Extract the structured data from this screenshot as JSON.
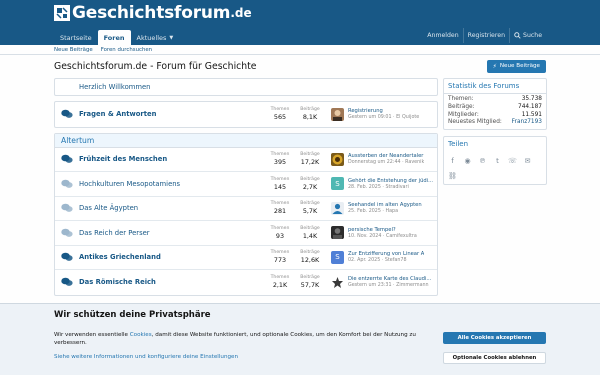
{
  "header": {
    "logo_text": "Geschichtsforum",
    "logo_tld": ".de",
    "nav": [
      {
        "label": "Startseite"
      },
      {
        "label": "Foren"
      },
      {
        "label": "Aktuelles"
      }
    ],
    "login": "Anmelden",
    "register": "Registrieren",
    "search": "Suche"
  },
  "subnav": [
    "Neue Beiträge",
    "Foren durchsuchen"
  ],
  "page": {
    "title": "Geschichtsforum.de - Forum für Geschichte",
    "new_posts_button": "Neue Beiträge"
  },
  "welcome": "Herzlich Willkommen",
  "labels": {
    "threads": "Themen",
    "posts": "Beiträge"
  },
  "qa_forum": {
    "name": "Fragen & Antworten",
    "threads": "565",
    "posts": "8,1K",
    "latest_title": "Registrierung",
    "latest_meta": "Gestern um 09:01 · El Quijote"
  },
  "section": {
    "title": "Altertum",
    "forums": [
      {
        "name": "Frühzeit des Menschen",
        "threads": "395",
        "posts": "17,2K",
        "latest_title": "Aussterben der Neandertaler",
        "latest_meta": "Donnerstag um 22:44 · Ravenik"
      },
      {
        "name": "Hochkulturen Mesopotamiens",
        "threads": "145",
        "posts": "2,7K",
        "latest_title": "Gehört die Entstehung der jüdi...",
        "latest_meta": "28. Feb. 2025 · Stradivari",
        "avatar_letter": "S"
      },
      {
        "name": "Das Alte Ägypten",
        "threads": "281",
        "posts": "5,7K",
        "latest_title": "Seehandel im alten Ägypten",
        "latest_meta": "25. Feb. 2025 · Hapa"
      },
      {
        "name": "Das Reich der Perser",
        "threads": "93",
        "posts": "1,4K",
        "latest_title": "persische Tempel?",
        "latest_meta": "10. Nov. 2024 · Camifexultra"
      },
      {
        "name": "Antikes Griechenland",
        "threads": "773",
        "posts": "12,6K",
        "latest_title": "Zur Entzifferung von Linear A",
        "latest_meta": "02. Apr. 2025 · Stefan78",
        "avatar_letter": "S"
      },
      {
        "name": "Das Römische Reich",
        "threads": "2,1K",
        "posts": "57,7K",
        "latest_title": "Die entzerrte Karte des Claudi...",
        "latest_meta": "Gestern um 23:31 · Zimmermann"
      }
    ]
  },
  "sidebar": {
    "stats_title": "Statistik des Forums",
    "stats": [
      {
        "label": "Themen:",
        "value": "35.738"
      },
      {
        "label": "Beiträge:",
        "value": "744.187"
      },
      {
        "label": "Mitglieder:",
        "value": "11.591"
      },
      {
        "label": "Neuestes Mitglied:",
        "value": "Franz7193"
      }
    ],
    "share_title": "Teilen"
  },
  "cookie": {
    "title": "Wir schützen deine Privatsphäre",
    "text_before": "Wir verwenden essentielle ",
    "text_link": "Cookies",
    "text_after": ", damit diese Website funktioniert, und optionale Cookies, um den Komfort bei der Nutzung zu verbessern.",
    "more_link": "Siehe weitere Informationen und konfiguriere deine Einstellungen",
    "accept": "Alle Cookies akzeptieren",
    "decline": "Optionale Cookies ablehnen"
  },
  "colors": {
    "header": "#185886",
    "accent": "#2577b1",
    "section_bg": "#edf6fd",
    "cookie_bg": "#edf2f7"
  }
}
